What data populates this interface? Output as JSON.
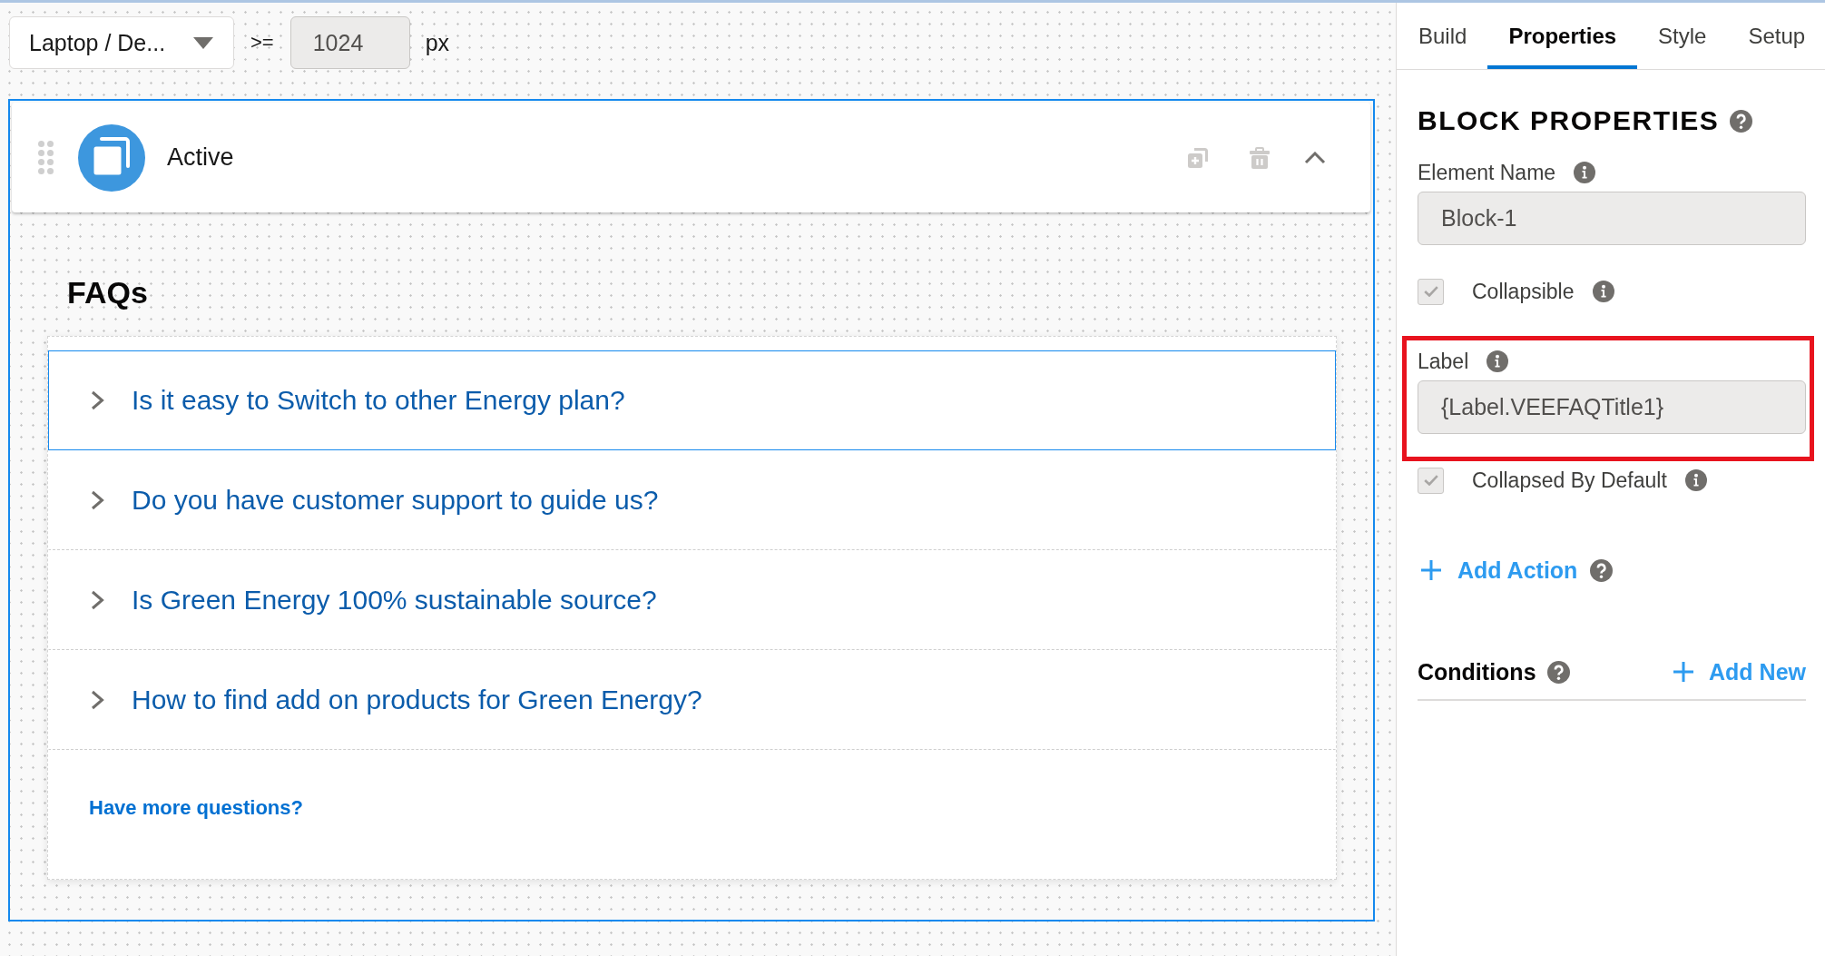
{
  "toolbar": {
    "device_dropdown": {
      "value": "Laptop / De..."
    },
    "operator": ">=",
    "min_width_field": {
      "value": "1024"
    },
    "unit": "px"
  },
  "block": {
    "title": "Active",
    "selected": true,
    "expanded": true,
    "actions": [
      {
        "kind": "duplicate",
        "disabled": true
      },
      {
        "kind": "delete",
        "disabled": true
      }
    ]
  },
  "faq": {
    "heading": "FAQs",
    "items": [
      {
        "question": "Is it easy to Switch to other Energy plan?",
        "selected": true,
        "expanded": false
      },
      {
        "question": "Do you have customer support to guide us?",
        "selected": false,
        "expanded": false
      },
      {
        "question": "Is Green Energy 100% sustainable source?",
        "selected": false,
        "expanded": false
      },
      {
        "question": "How to find add on products for Green Energy?",
        "selected": false,
        "expanded": false
      }
    ],
    "footer_link": "Have more questions?"
  },
  "properties_panel": {
    "tabs": [
      {
        "label": "Build",
        "selected": false
      },
      {
        "label": "Properties",
        "selected": true
      },
      {
        "label": "Style",
        "selected": false
      },
      {
        "label": "Setup",
        "selected": false
      }
    ],
    "heading": "BLOCK PROPERTIES",
    "fields": [
      {
        "kind": "text",
        "label": "Element Name",
        "value": "Block-1",
        "highlighted": false
      },
      {
        "kind": "checkbox",
        "label": "Collapsible",
        "checked": true,
        "disabled": true,
        "highlighted": false
      },
      {
        "kind": "text",
        "label": "Label",
        "value": "{Label.VEEFAQTitle1}",
        "highlighted": true
      },
      {
        "kind": "checkbox",
        "label": "Collapsed By Default",
        "checked": true,
        "disabled": true,
        "highlighted": false
      }
    ],
    "add_action": "Add Action",
    "conditions": {
      "heading": "Conditions",
      "add_new": "Add New"
    }
  }
}
